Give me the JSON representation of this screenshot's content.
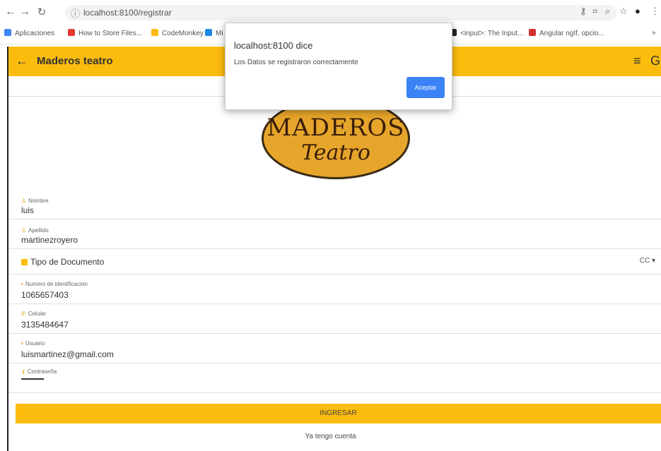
{
  "browser": {
    "url": "localhost:8100/registrar",
    "bookmarks": [
      {
        "label": "Aplicaciones",
        "color": "#4285f4"
      },
      {
        "label": "How to Store Files...",
        "color": "#e53935"
      },
      {
        "label": "CodeMonkey",
        "color": "#fbbc0e"
      },
      {
        "label": "Mi",
        "color": "#1e88e5"
      },
      {
        "label": "<input>: The Input...",
        "color": "#222222"
      },
      {
        "label": "Angular ngIf, opcio...",
        "color": "#d32f2f"
      }
    ]
  },
  "header": {
    "title": "Maderos teatro",
    "accent": "#fbbc0e"
  },
  "logo": {
    "line1": "MADEROS",
    "line2": "Teatro"
  },
  "form": {
    "nombre": {
      "label": "Nombre",
      "value": "luis"
    },
    "apellido": {
      "label": "Apellido",
      "value": "martinezroyero"
    },
    "tipo_documento": {
      "label": "Tipo de Documento",
      "value": "CC"
    },
    "identificacion": {
      "label": "Numero de identificacion",
      "value": "1065657403"
    },
    "celular": {
      "label": "Celular",
      "value": "3135484647"
    },
    "usuario": {
      "label": "Usuario",
      "value": "luismartinez@gmail.com"
    },
    "contrasena": {
      "label": "Contraseña"
    },
    "submit_label": "INGRESAR",
    "link_label": "Ya tengo cuenta"
  },
  "dialog": {
    "title": "localhost:8100 dice",
    "message": "Los Datos se registraron correctamente",
    "button_label": "Aceptar"
  }
}
